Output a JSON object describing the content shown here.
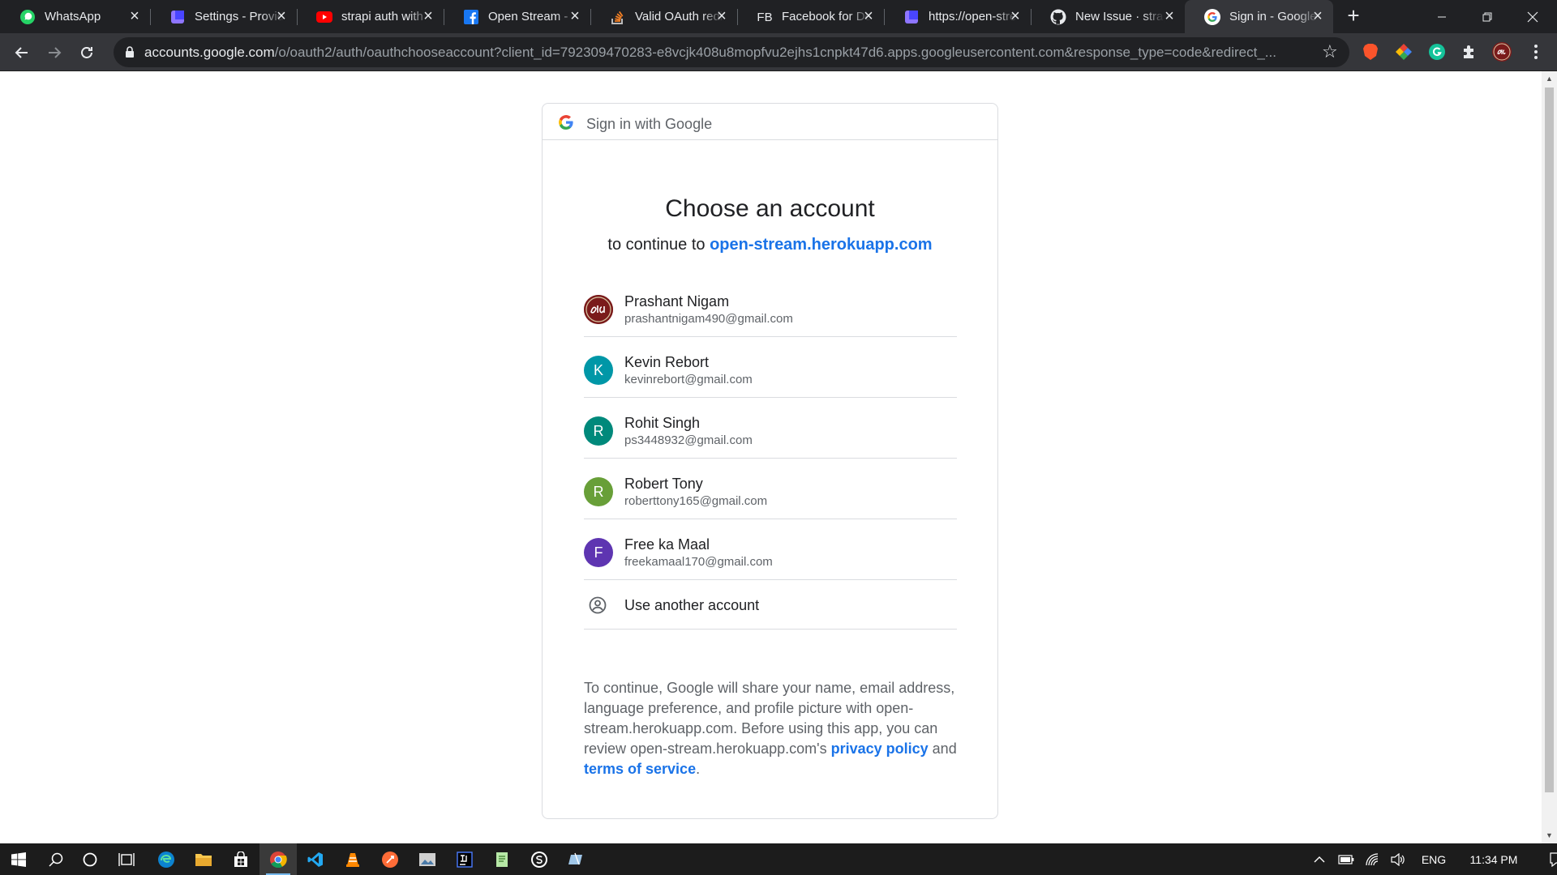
{
  "browser": {
    "tabs": [
      {
        "title": "WhatsApp",
        "icon": "whatsapp-icon",
        "active": false
      },
      {
        "title": "Settings - Providers",
        "icon": "strapi-icon",
        "active": false
      },
      {
        "title": "strapi auth with",
        "icon": "youtube-icon",
        "active": false
      },
      {
        "title": "Open Stream - ",
        "icon": "facebook-icon",
        "active": false
      },
      {
        "title": "Valid OAuth redirect",
        "icon": "stackoverflow-icon",
        "active": false
      },
      {
        "title": "Facebook for Developers",
        "icon": "fb-text-icon",
        "fav_text": "FB",
        "active": false
      },
      {
        "title": "https://open-stream",
        "icon": "strapi-icon",
        "active": false
      },
      {
        "title": "New Issue · strapi",
        "icon": "github-icon",
        "active": false
      },
      {
        "title": "Sign in - Google Accounts",
        "icon": "google-icon",
        "active": true
      }
    ],
    "new_tab_label": "+",
    "url_host": "accounts.google.com",
    "url_path": "/o/oauth2/auth/oauthchooseaccount?client_id=792309470283-e8vcjk408u8mopfvu2ejhs1cnpkt47d6.apps.googleusercontent.com&response_type=code&redirect_..."
  },
  "card": {
    "header_label": "Sign in with Google",
    "title": "Choose an account",
    "subtitle_prefix": "to continue to",
    "subtitle_link": "open-stream.herokuapp.com",
    "accounts": [
      {
        "name": "Prashant Nigam",
        "email": "prashantnigam490@gmail.com",
        "initial": "",
        "color": "#7a1b1b"
      },
      {
        "name": "Kevin Rebort",
        "email": "kevinrebort@gmail.com",
        "initial": "K",
        "color": "#0097a7"
      },
      {
        "name": "Rohit Singh",
        "email": "ps3448932@gmail.com",
        "initial": "R",
        "color": "#00897b"
      },
      {
        "name": "Robert Tony",
        "email": "roberttony165@gmail.com",
        "initial": "R",
        "color": "#689f38"
      },
      {
        "name": "Free ka Maal",
        "email": "freekamaal170@gmail.com",
        "initial": "F",
        "color": "#5e35b1"
      }
    ],
    "use_another": "Use another account",
    "footer_text": "To continue, Google will share your name, email address, language preference, and profile picture with open-stream.herokuapp.com. Before using this app, you can review open-stream.herokuapp.com's",
    "privacy_link": "privacy policy",
    "and_text": "and",
    "terms_link": "terms of service",
    "period": "."
  },
  "taskbar": {
    "language": "ENG",
    "time": "11:34 PM"
  }
}
